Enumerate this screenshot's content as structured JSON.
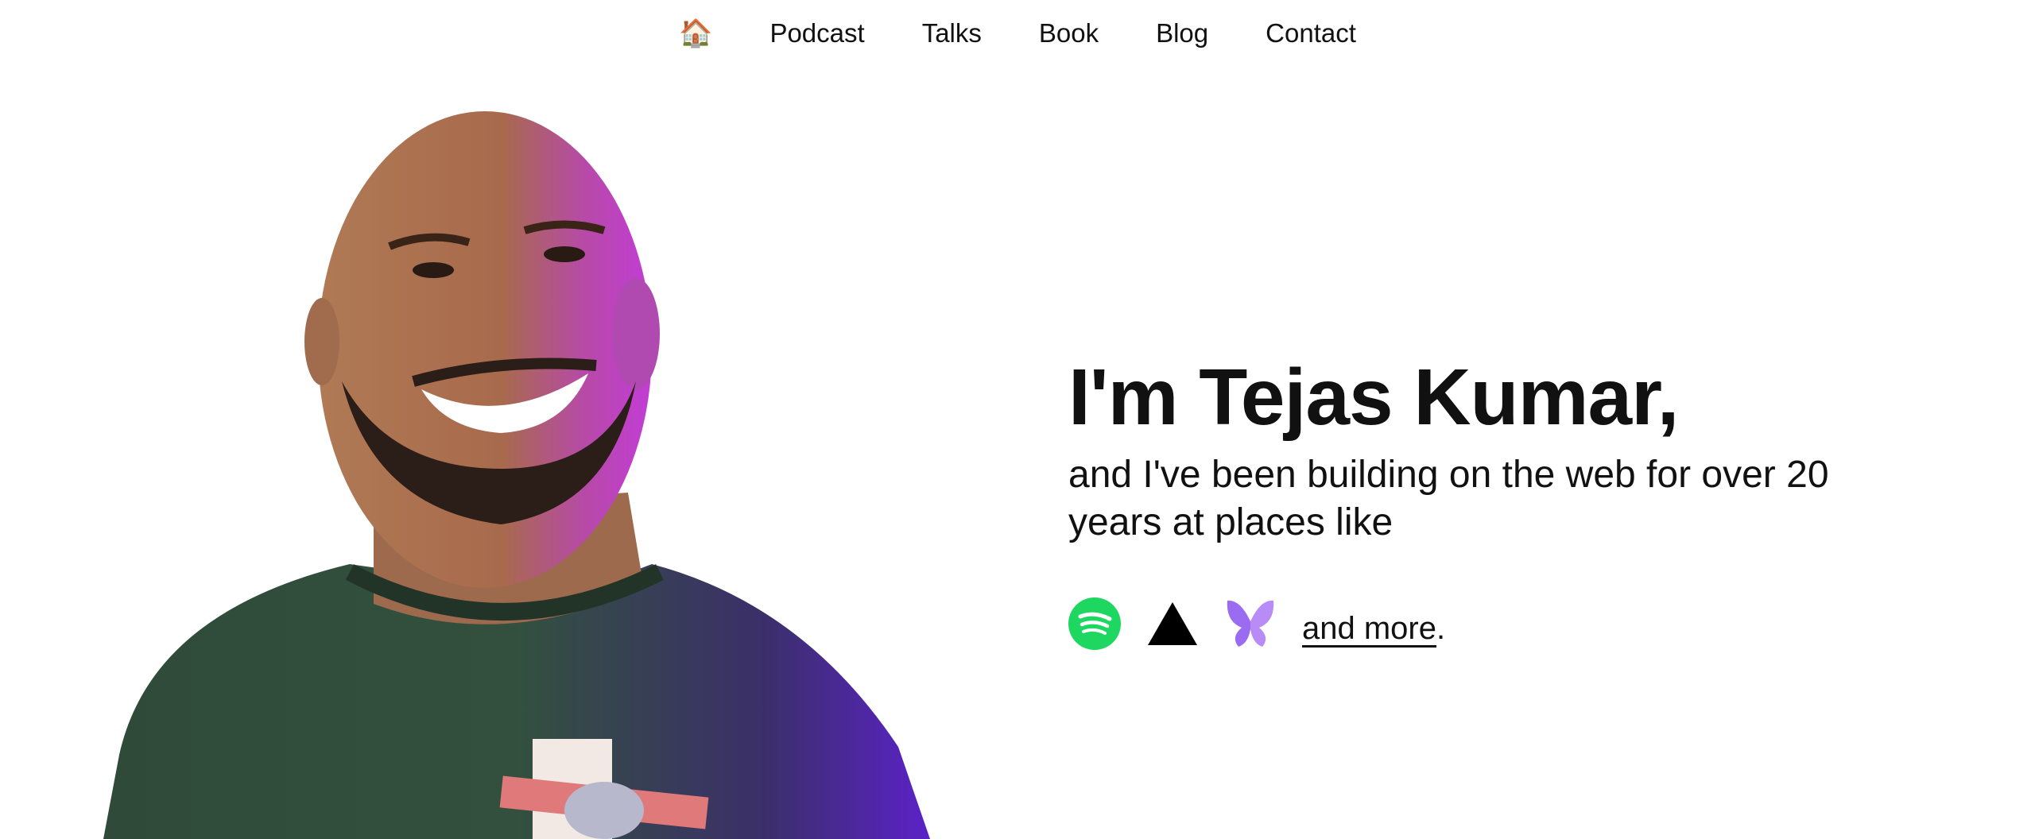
{
  "nav": {
    "home_icon": "house-emoji",
    "home_glyph": "🏠",
    "items": [
      {
        "label": "Podcast"
      },
      {
        "label": "Talks"
      },
      {
        "label": "Book"
      },
      {
        "label": "Blog"
      },
      {
        "label": "Contact"
      }
    ]
  },
  "hero": {
    "title": "I'm Tejas Kumar,",
    "subtitle": "and I've been building on the web for over 20 years at places like",
    "logos": [
      {
        "name": "spotify-logo",
        "color": "#1ED760"
      },
      {
        "name": "vercel-logo",
        "color": "#000000"
      },
      {
        "name": "butterfly-logo",
        "color": "#9B6CF2"
      }
    ],
    "more_link": "and more",
    "more_suffix": "."
  },
  "portrait": {
    "subject": "person-photo",
    "shirt_color": "#2f4f3c",
    "accent_color": "#c23cd6"
  }
}
